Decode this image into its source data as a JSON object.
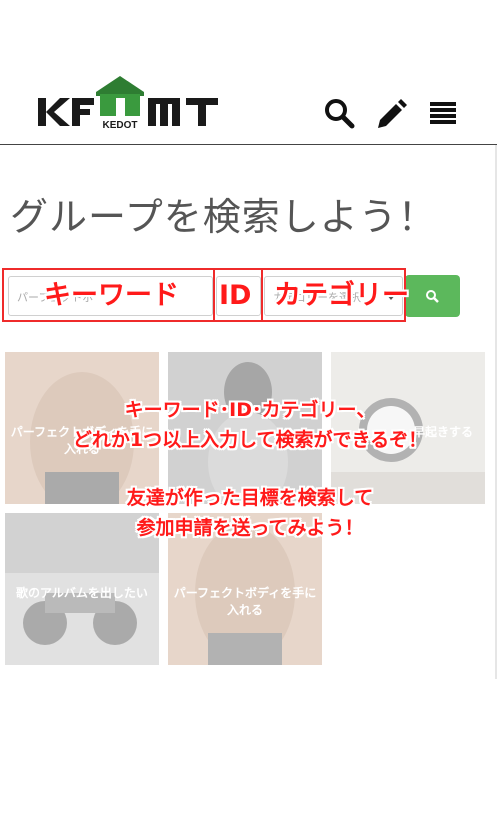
{
  "header": {
    "logo_text": "KEDOT",
    "icons": [
      "search-icon",
      "pencil-icon",
      "menu-icon"
    ]
  },
  "page": {
    "title": "グループを検索しよう！"
  },
  "search": {
    "keyword_placeholder": "パーフェクトボ",
    "category_placeholder": "カテゴリーを選択",
    "button_icon": "search-icon"
  },
  "annotations": {
    "keyword_label": "キーワード",
    "id_label": "ID",
    "category_label": "カテゴリー",
    "line1": "キーワード･ID･カテゴリー、",
    "line2": "どれか1つ以上入力して検索ができるぞ！",
    "line3": "友達が作った目標を検索して",
    "line4": "参加申請を送ってみよう！"
  },
  "tiles": [
    {
      "title": "パーフェクトボディを手に入れる"
    },
    {
      "title": ""
    },
    {
      "title": "早起きする"
    },
    {
      "title": "歌のアルバムを出したい"
    },
    {
      "title": "パーフェクトボディを手に入れる"
    }
  ],
  "colors": {
    "accent_green": "#5cb85c",
    "annotation_red": "#ff1a1a"
  }
}
